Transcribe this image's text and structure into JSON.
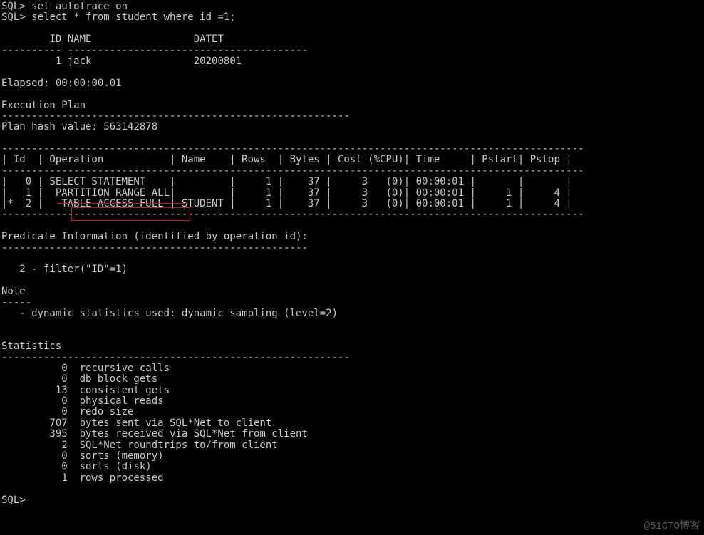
{
  "prompt": "SQL>",
  "commands": [
    "set autotrace on",
    "select * from student where id =1;"
  ],
  "result": {
    "headers": [
      "ID",
      "NAME",
      "DATET"
    ],
    "divider": "---------- ----------------------------------------",
    "row": {
      "id": "1",
      "name": "jack",
      "datet": "20200801"
    }
  },
  "elapsedLabel": "Elapsed:",
  "elapsedValue": "00:00:00.01",
  "execPlanHeader": "Execution Plan",
  "planHashLabel": "Plan hash value:",
  "planHashValue": "563142878",
  "planDivider": "----------------------------------------------------------",
  "planWideDivider": "-------------------------------------------------------------------------------------------------",
  "planColsRaw": "| Id  | Operation           | Name    | Rows  | Bytes | Cost (%CPU)| Time     | Pstart| Pstop |",
  "planRowsRaw": [
    "|   0 | SELECT STATEMENT    |         |     1 |    37 |     3   (0)| 00:00:01 |       |       |",
    "|   1 |  PARTITION RANGE ALL|         |     1 |    37 |     3   (0)| 00:00:01 |     1 |     4 |",
    "|*  2 |   TABLE ACCESS FULL | STUDENT |     1 |    37 |     3   (0)| 00:00:01 |     1 |     4 |"
  ],
  "predHeader": "Predicate Information (identified by operation id):",
  "predDivider": "---------------------------------------------------",
  "predLine": "   2 - filter(\"ID\"=1)",
  "noteHeader": "Note",
  "noteDivider": "-----",
  "noteLine": "   - dynamic statistics used: dynamic sampling (level=2)",
  "statsHeader": "Statistics",
  "statsItems": [
    {
      "n": "0",
      "t": "recursive calls"
    },
    {
      "n": "0",
      "t": "db block gets"
    },
    {
      "n": "13",
      "t": "consistent gets"
    },
    {
      "n": "0",
      "t": "physical reads"
    },
    {
      "n": "0",
      "t": "redo size"
    },
    {
      "n": "707",
      "t": "bytes sent via SQL*Net to client"
    },
    {
      "n": "395",
      "t": "bytes received via SQL*Net from client"
    },
    {
      "n": "2",
      "t": "SQL*Net roundtrips to/from client"
    },
    {
      "n": "0",
      "t": "sorts (memory)"
    },
    {
      "n": "0",
      "t": "sorts (disk)"
    },
    {
      "n": "1",
      "t": "rows processed"
    }
  ],
  "watermark": "@51CTO博客"
}
